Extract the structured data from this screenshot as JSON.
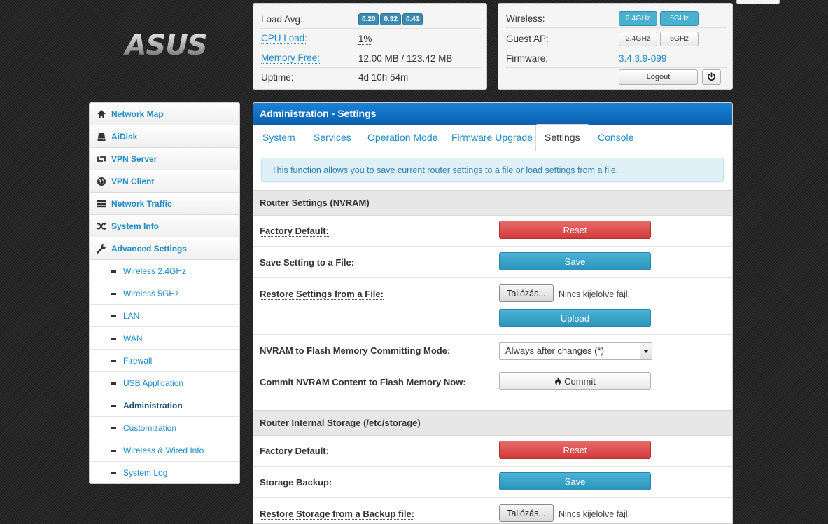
{
  "logo": {
    "text": "ASUS"
  },
  "status": {
    "load_avg_label": "Load Avg:",
    "load_avg": [
      "0.20",
      "0.32",
      "0.41"
    ],
    "cpu_label": "CPU Load:",
    "cpu_value": "1%",
    "mem_label": "Memory Free:",
    "mem_value": "12.00 MB / 123.42 MB",
    "uptime_label": "Uptime:",
    "uptime_value": "4d 10h 54m"
  },
  "status2": {
    "wireless_label": "Wireless:",
    "wireless_24": "2.4GHz",
    "wireless_5": "5GHz",
    "guest_label": "Guest AP:",
    "guest_24": "2.4GHz",
    "guest_5": "5GHz",
    "firmware_label": "Firmware:",
    "firmware_value": "3.4.3.9-099",
    "logout_label": "Logout"
  },
  "sidebar": {
    "items": [
      {
        "label": "Network Map",
        "icon": "home-icon"
      },
      {
        "label": "AiDisk",
        "icon": "drive-icon"
      },
      {
        "label": "VPN Server",
        "icon": "retweet-icon"
      },
      {
        "label": "VPN Client",
        "icon": "globe-icon"
      },
      {
        "label": "Network Traffic",
        "icon": "server-icon"
      },
      {
        "label": "System Info",
        "icon": "shuffle-icon"
      },
      {
        "label": "Advanced Settings",
        "icon": "wrench-icon"
      }
    ],
    "subitems": [
      {
        "label": "Wireless 2.4GHz"
      },
      {
        "label": "Wireless 5GHz"
      },
      {
        "label": "LAN"
      },
      {
        "label": "WAN"
      },
      {
        "label": "Firewall"
      },
      {
        "label": "USB Application"
      },
      {
        "label": "Administration"
      },
      {
        "label": "Customization"
      },
      {
        "label": "Wireless & Wired Info"
      },
      {
        "label": "System Log"
      }
    ]
  },
  "main": {
    "title": "Administration - Settings",
    "tabs": [
      "System",
      "Services",
      "Operation Mode",
      "Firmware Upgrade",
      "Settings",
      "Console"
    ],
    "active_tab": "Settings",
    "info": "This function allows you to save current router settings to a file or load settings from a file.",
    "section1": "Router Settings (NVRAM)",
    "factory_label": "Factory Default:",
    "reset_label": "Reset",
    "save_label": "Save Setting to a File:",
    "save_btn": "Save",
    "restore_label": "Restore Settings from a File:",
    "browse_btn": "Tallózás...",
    "no_file": "Nincs kijelölve fájl.",
    "upload_btn": "Upload",
    "commit_mode_label": "NVRAM to Flash Memory Committing Mode:",
    "commit_mode_value": "Always after changes (*)",
    "commit_now_label": "Commit NVRAM Content to Flash Memory Now:",
    "commit_btn": "Commit",
    "section2": "Router Internal Storage (/etc/storage)",
    "storage_factory_label": "Factory Default:",
    "storage_reset": "Reset",
    "storage_backup_label": "Storage Backup:",
    "storage_save": "Save",
    "storage_restore_label": "Restore Storage from a Backup file:",
    "storage_browse": "Tallózás...",
    "storage_no_file": "Nincs kijelölve fájl."
  },
  "colors": {
    "accent": "#1e8bc3",
    "header": "#0a5fae",
    "danger": "#d23a3a",
    "primary": "#2c93bb"
  }
}
